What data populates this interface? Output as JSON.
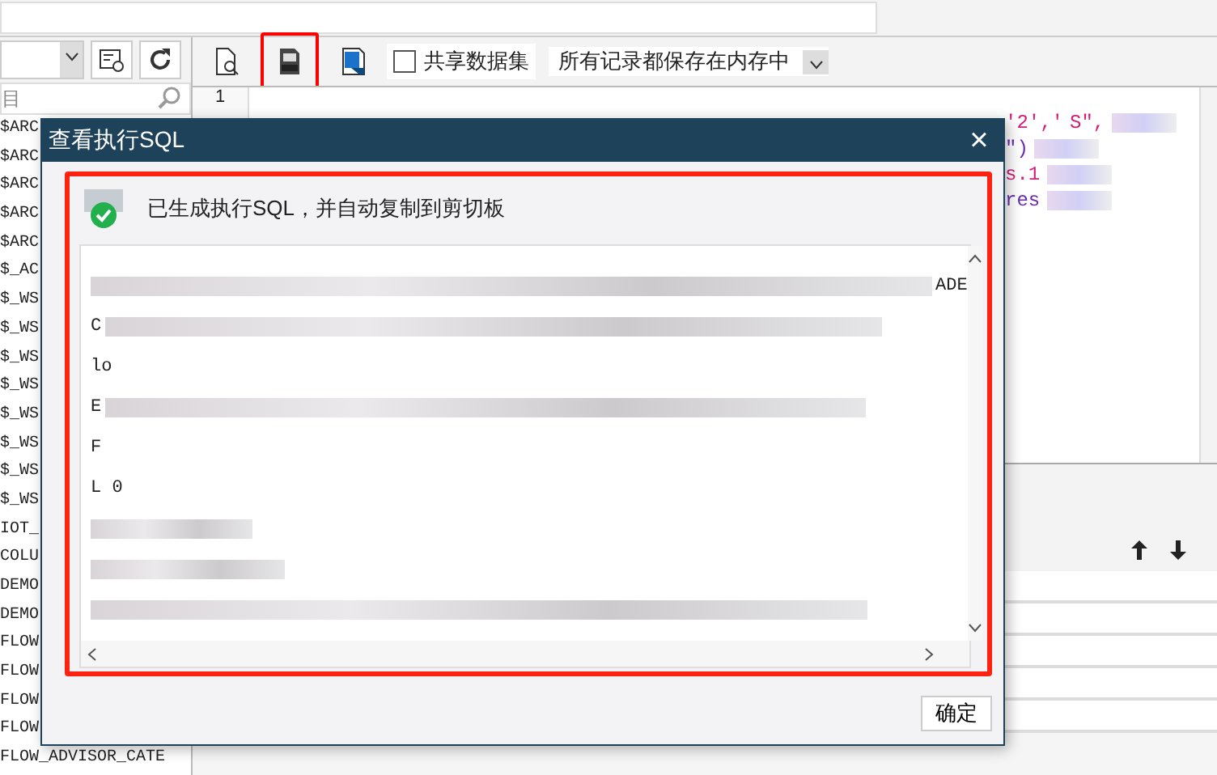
{
  "toolbar": {
    "tools": [
      {
        "kind": "preview",
        "highlighted": false
      },
      {
        "kind": "sql",
        "highlighted": true
      },
      {
        "kind": "export",
        "highlighted": false
      }
    ],
    "share_checkbox": {
      "label": "共享数据集",
      "checked": false
    },
    "storage_select": {
      "value": "所有记录都保存在内存中"
    }
  },
  "sidebar": {
    "search_placeholder": "目",
    "items": [
      "$ARC",
      "$ARC",
      "$ARC",
      "$ARC",
      "$ARC",
      "$_AC",
      "$_WS",
      "$_WS",
      "$_WS",
      "$_WS",
      "$_WS",
      "$_WS",
      "$_WS",
      "$_WS",
      "IOT_",
      "COLU",
      "DEMO",
      "DEMO",
      "FLOW",
      "FLOW",
      "FLOW",
      "FLOW",
      "FLOW_ADVISOR_CATE"
    ]
  },
  "editor": {
    "line_numbers": [
      "1"
    ],
    "lines": [
      {
        "fragments": [
          "'2','",
          "S\","
        ]
      },
      {
        "fragments": [
          "\")"
        ]
      },
      {
        "fragments": [
          "s.1"
        ]
      },
      {
        "fragments": [
          "res"
        ]
      }
    ]
  },
  "dialog": {
    "title": "查看执行SQL",
    "close": "×",
    "message": "已生成执行SQL，并自动复制到剪切板",
    "highlighted": true,
    "sql_lines": [
      {
        "tail": "ADE"
      },
      {
        "head": "C"
      },
      {
        "tail": "lo"
      },
      {
        "head": "E"
      },
      {
        "head": "F"
      },
      {
        "head": "L 0"
      }
    ],
    "ok_button": "确定"
  }
}
